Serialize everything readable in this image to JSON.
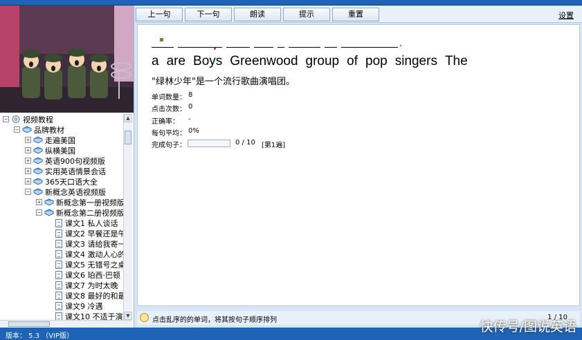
{
  "toolbar": {
    "buttons": [
      "上一句",
      "下一句",
      "朗读",
      "提示",
      "重置"
    ],
    "settings": "设置"
  },
  "tree": {
    "items": [
      {
        "label": "视频教程",
        "level": 0,
        "expander": "⊟",
        "icon": "disc"
      },
      {
        "label": "品牌教材",
        "level": 1,
        "expander": "⊟",
        "icon": "book"
      },
      {
        "label": "走遍美国",
        "level": 2,
        "expander": "⊞",
        "icon": "book"
      },
      {
        "label": "纵横美国",
        "level": 2,
        "expander": "⊞",
        "icon": "book"
      },
      {
        "label": "英语900句视频版",
        "level": 2,
        "expander": "⊞",
        "icon": "book"
      },
      {
        "label": "实用英语情景会话",
        "level": 2,
        "expander": "⊞",
        "icon": "book"
      },
      {
        "label": "365天口语大全",
        "level": 2,
        "expander": "⊞",
        "icon": "book"
      },
      {
        "label": "新概念英语视频版",
        "level": 2,
        "expander": "⊟",
        "icon": "book"
      },
      {
        "label": "新概念第一册视频版",
        "level": 3,
        "expander": "⊞",
        "icon": "book"
      },
      {
        "label": "新概念第二册视频版",
        "level": 3,
        "expander": "⊟",
        "icon": "book"
      },
      {
        "label": "课文1 私人谈话",
        "level": 4,
        "icon": "doc"
      },
      {
        "label": "课文2 早餐还是午",
        "level": 4,
        "icon": "doc"
      },
      {
        "label": "课文3 请给我寄一",
        "level": 4,
        "icon": "doc"
      },
      {
        "label": "课文4 激动人心的",
        "level": 4,
        "icon": "doc"
      },
      {
        "label": "课文5 无错号之桌",
        "level": 4,
        "icon": "doc"
      },
      {
        "label": "课文6 珀西·巴顿",
        "level": 4,
        "icon": "doc"
      },
      {
        "label": "课文7 为时太晚",
        "level": 4,
        "icon": "doc"
      },
      {
        "label": "课文8 最好的和最",
        "level": 4,
        "icon": "doc"
      },
      {
        "label": "课文9 冷遇",
        "level": 4,
        "icon": "doc"
      },
      {
        "label": "课文10 不适于演",
        "level": 4,
        "icon": "doc"
      }
    ]
  },
  "exercise": {
    "words": [
      "a",
      "are",
      "Boys",
      "Greenwood",
      "group",
      "of",
      "pop",
      "singers",
      "The"
    ],
    "period": ".",
    "translation": "\"绿林少年\"是一个流行歌曲演唱团。",
    "stats": [
      {
        "label": "单词数量：",
        "value": "8"
      },
      {
        "label": "点击次数：",
        "value": "0"
      },
      {
        "label": "正确率：",
        "value": "-"
      },
      {
        "label": "每句平均：",
        "value": "0%"
      }
    ],
    "completed_label": "完成句子：",
    "completed_value": "0 / 10",
    "round": "[第1遍]",
    "progress_fraction": 0
  },
  "hint_bar": {
    "text": "点击乱序的的单词，将其按句子顺序排列",
    "page": "1 / 10"
  },
  "statusbar": {
    "version": "版本： 5.3    （VIP版）"
  },
  "watermark": "快传号/图说英语",
  "colors": {
    "titlebar": "#1e63b5",
    "panel_bg": "#e8f0f9",
    "button_border": "#8ea8c8"
  }
}
